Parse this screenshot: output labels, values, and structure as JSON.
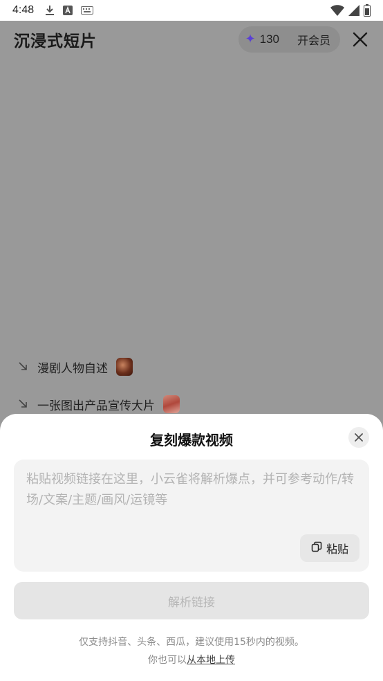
{
  "status_bar": {
    "time": "4:48",
    "icons": [
      "download-icon",
      "a-box-icon",
      "keyboard-icon",
      "wifi-icon",
      "signal-icon",
      "battery-icon"
    ]
  },
  "header": {
    "title": "沉浸式短片",
    "credits_icon": "sparkle-star-icon",
    "credits": "130",
    "vip_label": "开会员",
    "close_icon": "close-icon"
  },
  "suggestions": [
    {
      "icon": "arrow-down-right-icon",
      "label": "漫剧人物自述"
    },
    {
      "icon": "arrow-down-right-icon",
      "label": "一张图出产品宣传大片"
    }
  ],
  "sheet": {
    "title": "复刻爆款视频",
    "close_icon": "close-icon",
    "input_value": "",
    "input_placeholder": "粘贴视频链接在这里，小云雀将解析爆点，并可参考动作/转场/文案/主题/画风/运镜等",
    "paste_label": "粘贴",
    "paste_icon": "paste-icon",
    "parse_label": "解析链接",
    "hint_line1": "仅支持抖音、头条、西瓜，建议使用15秒内的视频。",
    "hint_line2_prefix": "你也可以",
    "hint_line2_link": "从本地上传"
  },
  "colors": {
    "backdrop": "#999999",
    "accent_star": "#5a3fd6",
    "input_bg": "#f3f3f3",
    "disabled_button": "#e5e5e5"
  }
}
